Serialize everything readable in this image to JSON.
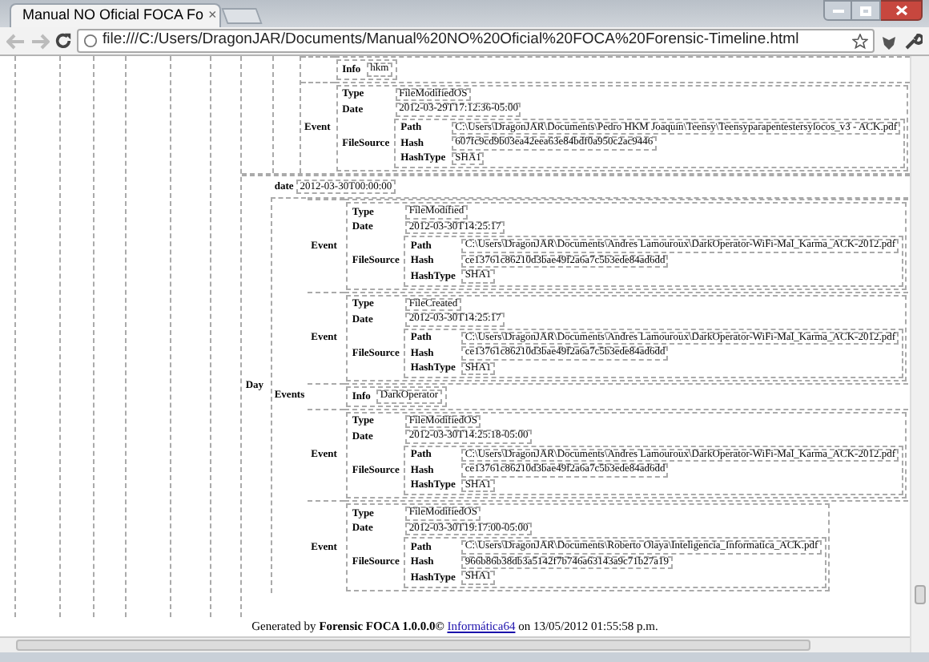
{
  "browser": {
    "tab_title": "Manual NO Oficial FOCA Fo",
    "tab_close": "×",
    "url": "file:///C:/Users/DragonJAR/Documents/Manual%20NO%20Oficial%20FOCA%20Forensic-Timeline.html"
  },
  "previous_events": [
    {
      "kind": "info",
      "key": "Info",
      "value": "hkm"
    },
    {
      "kind": "event",
      "label": "Event",
      "fields": [
        {
          "kind": "field",
          "key": "Type",
          "value": "FileModifiedOS"
        },
        {
          "kind": "field",
          "key": "Date",
          "value": "2012-03-29T17:12:36-05:00"
        },
        {
          "kind": "group",
          "key": "FileSource",
          "fields": [
            {
              "kind": "field",
              "key": "Path",
              "value": "C:\\Users\\DragonJAR\\Documents\\Pedro HKM Joaquin\\Teensy\\Teensyparapentestersylocos_v3 - ACK.pdf"
            },
            {
              "kind": "field",
              "key": "Hash",
              "value": "607fc9cd9b03ea42eea63e84bdf0a950c2ac9446"
            },
            {
              "kind": "field",
              "key": "HashType",
              "value": "SHA1"
            }
          ]
        }
      ]
    }
  ],
  "day": {
    "label": "Day",
    "date_key": "date",
    "date": "2012-03-30T00:00:00",
    "events_label": "Events",
    "events": [
      {
        "kind": "event",
        "label": "Event",
        "fields": [
          {
            "kind": "field",
            "key": "Type",
            "value": "FileModified"
          },
          {
            "kind": "field",
            "key": "Date",
            "value": "2012-03-30T14:25:17"
          },
          {
            "kind": "group",
            "key": "FileSource",
            "fields": [
              {
                "kind": "field",
                "key": "Path",
                "value": "C:\\Users\\DragonJAR\\Documents\\Andres Lamouroux\\DarkOperator-WiFi-Mal_Karma_ACK-2012.pdf"
              },
              {
                "kind": "field",
                "key": "Hash",
                "value": "ce13761c86210d3bae49f2a6a7c5b3ede84ad6dd"
              },
              {
                "kind": "field",
                "key": "HashType",
                "value": "SHA1"
              }
            ]
          }
        ]
      },
      {
        "kind": "event",
        "label": "Event",
        "fields": [
          {
            "kind": "field",
            "key": "Type",
            "value": "FileCreated"
          },
          {
            "kind": "field",
            "key": "Date",
            "value": "2012-03-30T14:25:17"
          },
          {
            "kind": "group",
            "key": "FileSource",
            "fields": [
              {
                "kind": "field",
                "key": "Path",
                "value": "C:\\Users\\DragonJAR\\Documents\\Andres Lamouroux\\DarkOperator-WiFi-Mal_Karma_ACK-2012.pdf"
              },
              {
                "kind": "field",
                "key": "Hash",
                "value": "ce13761c86210d3bae49f2a6a7c5b3ede84ad6dd"
              },
              {
                "kind": "field",
                "key": "HashType",
                "value": "SHA1"
              }
            ]
          }
        ]
      },
      {
        "kind": "info",
        "key": "Info",
        "value": "DarkOperator"
      },
      {
        "kind": "event",
        "label": "Event",
        "fields": [
          {
            "kind": "field",
            "key": "Type",
            "value": "FileModifiedOS"
          },
          {
            "kind": "field",
            "key": "Date",
            "value": "2012-03-30T14:25:18-05:00"
          },
          {
            "kind": "group",
            "key": "FileSource",
            "fields": [
              {
                "kind": "field",
                "key": "Path",
                "value": "C:\\Users\\DragonJAR\\Documents\\Andres Lamouroux\\DarkOperator-WiFi-Mal_Karma_ACK-2012.pdf"
              },
              {
                "kind": "field",
                "key": "Hash",
                "value": "ce13761c86210d3bae49f2a6a7c5b3ede84ad6dd"
              },
              {
                "kind": "field",
                "key": "HashType",
                "value": "SHA1"
              }
            ]
          }
        ]
      },
      {
        "kind": "event",
        "label": "Event",
        "fields": [
          {
            "kind": "field",
            "key": "Type",
            "value": "FileModifiedOS"
          },
          {
            "kind": "field",
            "key": "Date",
            "value": "2012-03-30T19:17:00-05:00"
          },
          {
            "kind": "group",
            "key": "FileSource",
            "fields": [
              {
                "kind": "field",
                "key": "Path",
                "value": "C:\\Users\\DragonJAR\\Documents\\Roberto Olaya\\Inteligencia_Informatica_ACK.pdf"
              },
              {
                "kind": "field",
                "key": "Hash",
                "value": "966b86b38db3a5142f7b746a63143a9c71b27a19"
              },
              {
                "kind": "field",
                "key": "HashType",
                "value": "SHA1"
              }
            ]
          }
        ]
      }
    ]
  },
  "footer": {
    "text": "Generated by **Forensic FOCA 1.0.0.0©**",
    "link": "Informática64",
    "after": "on 13/05/2012 01:55:58 p.m."
  }
}
